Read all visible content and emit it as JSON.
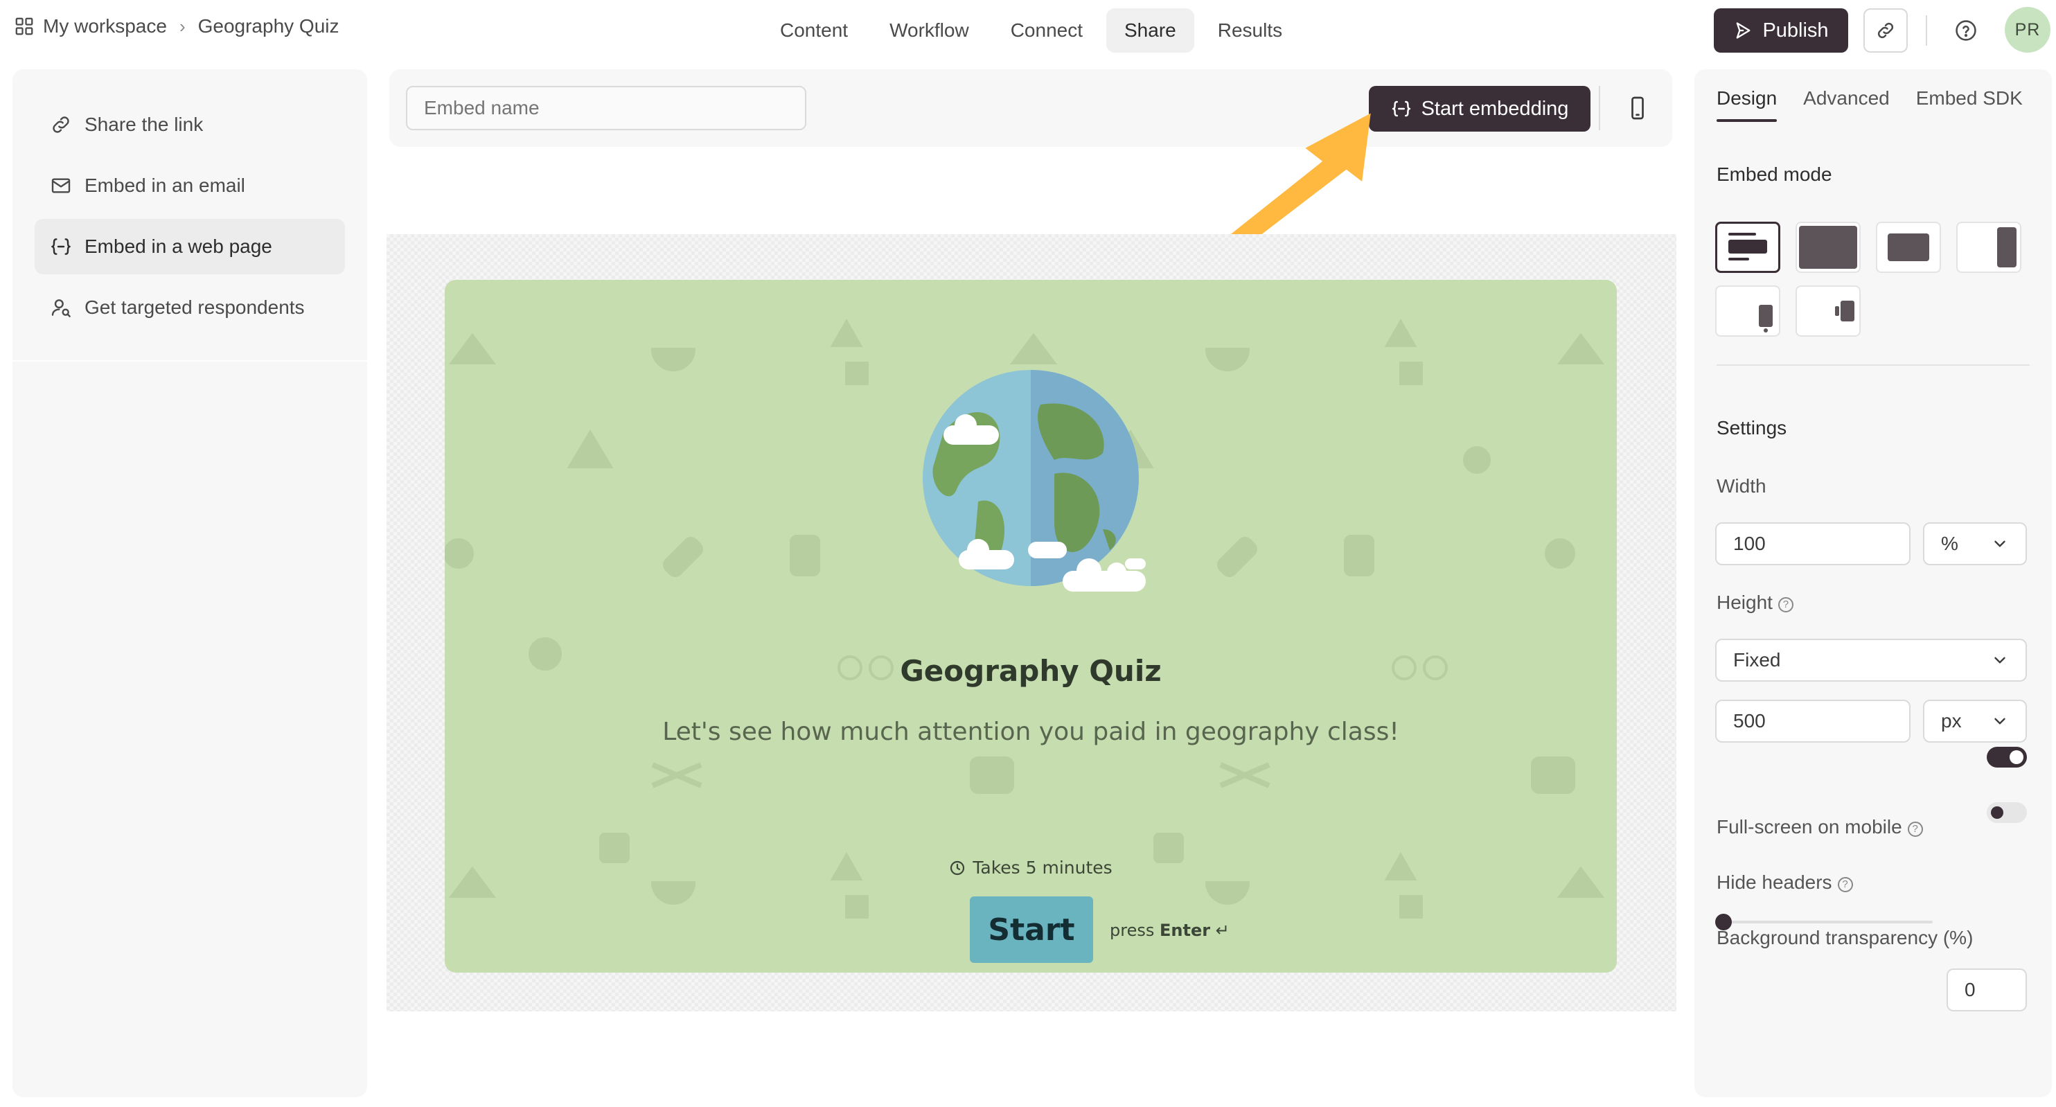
{
  "breadcrumb": {
    "workspace": "My workspace",
    "separator": "›",
    "form": "Geography Quiz"
  },
  "nav": {
    "tabs": [
      "Content",
      "Workflow",
      "Connect",
      "Share",
      "Results"
    ],
    "active": "Share"
  },
  "header": {
    "publish_label": "Publish",
    "avatar_initials": "PR"
  },
  "sidebar": {
    "items": [
      {
        "label": "Share the link",
        "icon": "link-icon"
      },
      {
        "label": "Embed in an email",
        "icon": "envelope-icon"
      },
      {
        "label": "Embed in a web page",
        "icon": "code-braces-icon",
        "active": true
      },
      {
        "label": "Get targeted respondents",
        "icon": "person-search-icon"
      }
    ]
  },
  "embed": {
    "name_placeholder": "Embed name",
    "start_label": "Start embedding"
  },
  "preview": {
    "title": "Geography Quiz",
    "subtitle": "Let's see how much attention you paid in geography class!",
    "duration": "Takes 5 minutes",
    "start_label": "Start",
    "hint_prefix": "press",
    "hint_key": "Enter",
    "hint_symbol": "↵",
    "background_color": "#c6ddaf",
    "button_color": "#6ab4c0"
  },
  "panel": {
    "tabs": [
      "Design",
      "Advanced",
      "Embed SDK"
    ],
    "active_tab": "Design",
    "embed_mode_label": "Embed mode",
    "settings_label": "Settings",
    "width_label": "Width",
    "width_value": "100",
    "width_unit": "%",
    "height_label": "Height",
    "height_mode": "Fixed",
    "height_value": "500",
    "height_unit": "px",
    "fullscreen_label": "Full-screen on mobile",
    "fullscreen_on": true,
    "hide_headers_label": "Hide headers",
    "hide_headers_on": false,
    "bg_transparency_label": "Background transparency (%)",
    "bg_transparency_value": "0"
  },
  "colors": {
    "accent": "#3a2f36",
    "arrow": "#ffb940",
    "avatar_bg": "#c8e3c0"
  }
}
